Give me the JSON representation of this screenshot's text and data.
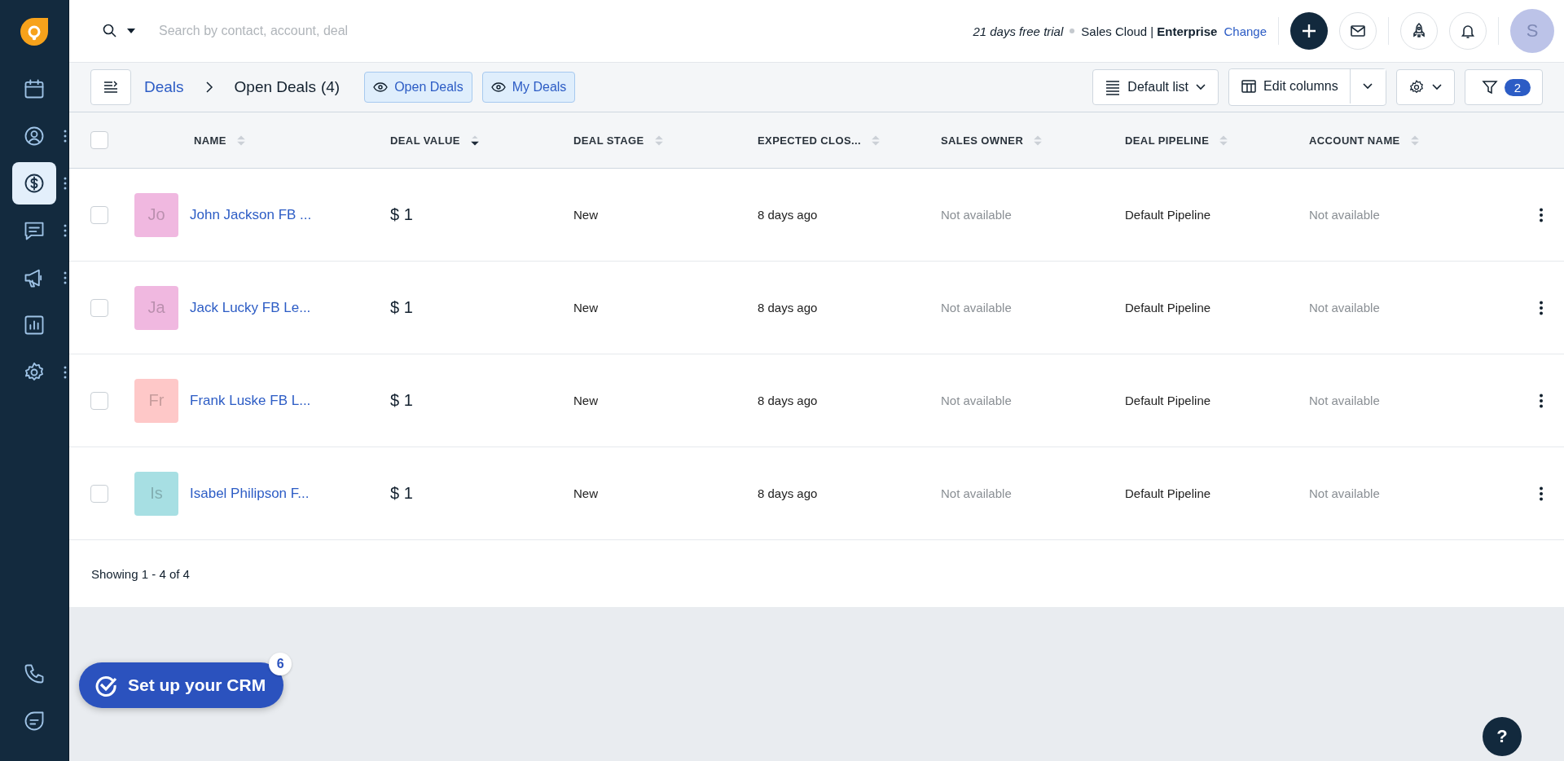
{
  "sidebar": {
    "top": [
      {
        "kind": "calendar",
        "selected": false,
        "has_menu": false
      },
      {
        "kind": "contact",
        "selected": false,
        "has_menu": true
      },
      {
        "kind": "dollar",
        "selected": true,
        "has_menu": true
      },
      {
        "kind": "chat",
        "selected": false,
        "has_menu": true
      },
      {
        "kind": "megaphone",
        "selected": false,
        "has_menu": true
      },
      {
        "kind": "report",
        "selected": false,
        "has_menu": false
      },
      {
        "kind": "gear",
        "selected": false,
        "has_menu": true
      }
    ],
    "bottom": [
      {
        "kind": "phone",
        "selected": false,
        "has_menu": false
      },
      {
        "kind": "bubble",
        "selected": false,
        "has_menu": false
      }
    ]
  },
  "search": {
    "placeholder": "Search by contact, account, deal"
  },
  "trial": {
    "text": "21 days free trial",
    "plan": "Sales Cloud |",
    "edition": "Enterprise",
    "link": "Change"
  },
  "avatar": "S",
  "breadcrumb": {
    "root": "Deals",
    "current": "Open Deals",
    "count": "(4)"
  },
  "views": [
    "Open Deals",
    "My Deals"
  ],
  "toolbar": {
    "list": "Default list",
    "columns": "Edit columns",
    "filter_count": "2"
  },
  "table": {
    "all_checked": false,
    "columns": [
      {
        "label": "NAME",
        "sorted": false
      },
      {
        "label": "DEAL VALUE",
        "sorted": true
      },
      {
        "label": "DEAL STAGE",
        "sorted": false
      },
      {
        "label": "EXPECTED CLOS...",
        "sorted": false
      },
      {
        "label": "SALES OWNER",
        "sorted": false
      },
      {
        "label": "DEAL PIPELINE",
        "sorted": false
      },
      {
        "label": "ACCOUNT NAME",
        "sorted": false
      }
    ],
    "rows": [
      {
        "checked": false,
        "initials": "Jo",
        "color": "#f0b8e0",
        "name": "John Jackson FB ...",
        "value": "$ 1",
        "stage": "New",
        "close": "8 days ago",
        "owner": "Not available",
        "pipeline": "Default Pipeline",
        "account": "Not available"
      },
      {
        "checked": false,
        "initials": "Ja",
        "color": "#f0b8e0",
        "name": "Jack Lucky FB Le...",
        "value": "$ 1",
        "stage": "New",
        "close": "8 days ago",
        "owner": "Not available",
        "pipeline": "Default Pipeline",
        "account": "Not available"
      },
      {
        "checked": false,
        "initials": "Fr",
        "color": "#fec8c8",
        "name": "Frank Luske FB L...",
        "value": "$ 1",
        "stage": "New",
        "close": "8 days ago",
        "owner": "Not available",
        "pipeline": "Default Pipeline",
        "account": "Not available"
      },
      {
        "checked": false,
        "initials": "Is",
        "color": "#a7dfe3",
        "name": "Isabel Philipson F...",
        "value": "$ 1",
        "stage": "New",
        "close": "8 days ago",
        "owner": "Not available",
        "pipeline": "Default Pipeline",
        "account": "Not available"
      }
    ]
  },
  "footer": "Showing 1 - 4 of 4",
  "setup": {
    "label": "Set up your CRM",
    "badge": "6"
  },
  "help": "?"
}
